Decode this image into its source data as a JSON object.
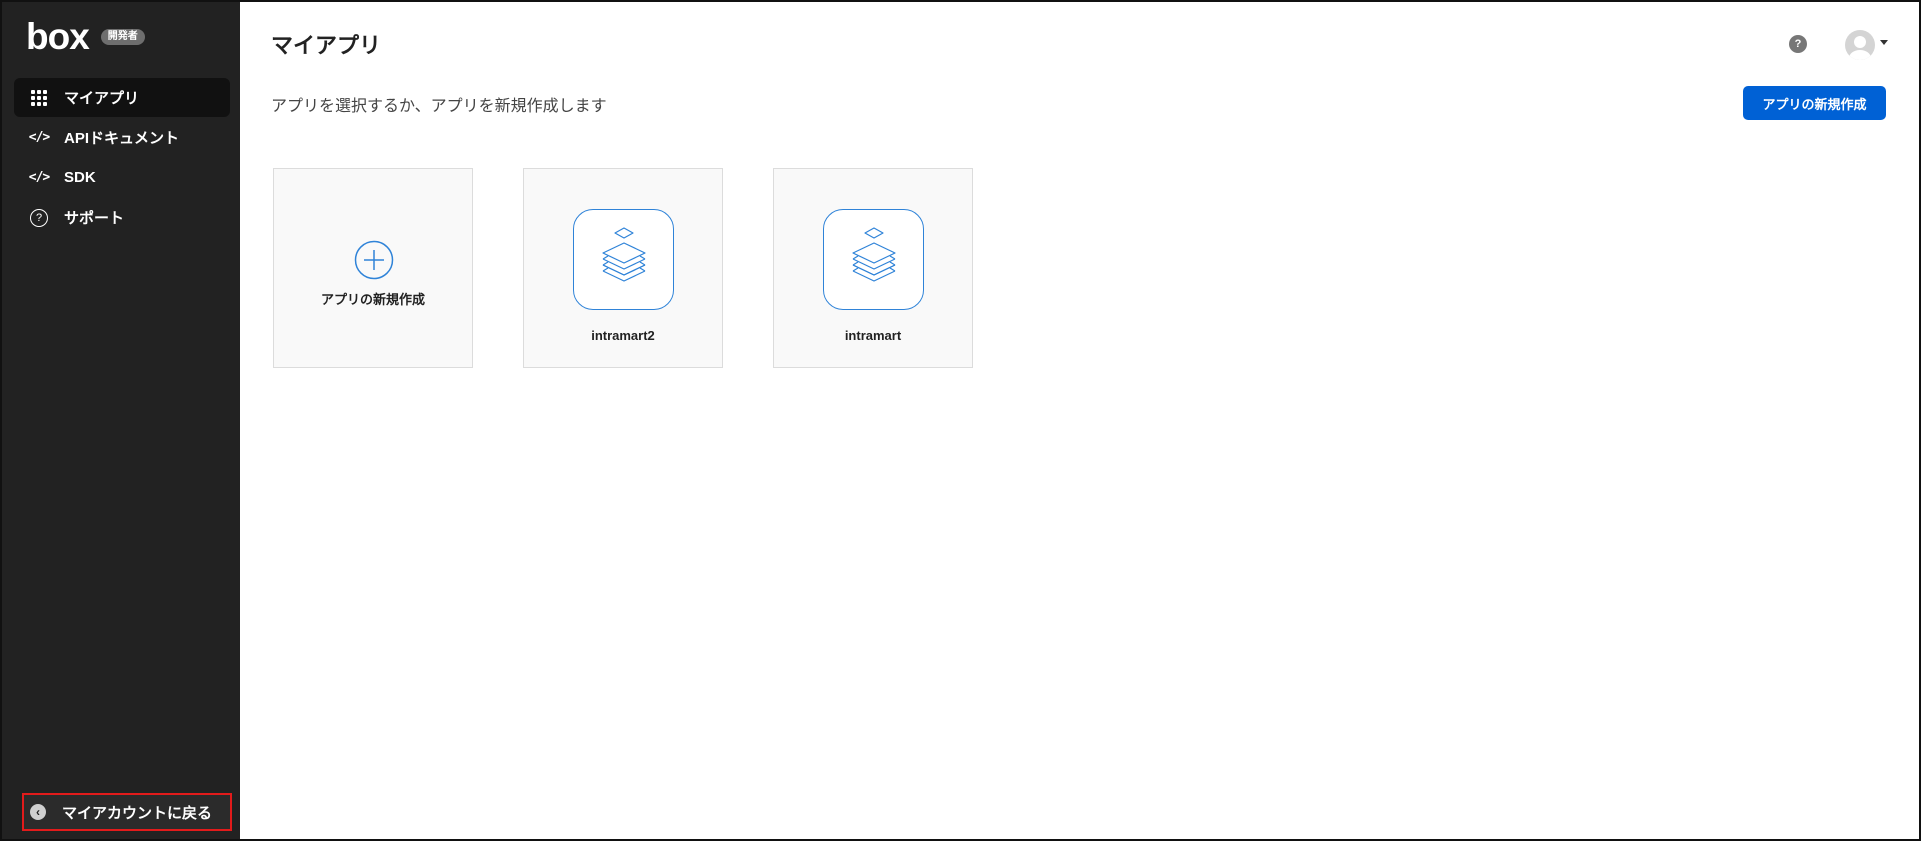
{
  "brand": {
    "logo_text": "box",
    "badge": "開発者"
  },
  "sidebar": {
    "items": [
      {
        "label": "マイアプリ",
        "icon": "grid-icon",
        "active": true
      },
      {
        "label": "APIドキュメント",
        "icon": "code-icon",
        "active": false
      },
      {
        "label": "SDK",
        "icon": "code-icon",
        "active": false
      },
      {
        "label": "サポート",
        "icon": "help-circle-icon",
        "active": false
      }
    ],
    "code_glyph": "</>",
    "help_glyph": "?",
    "back_label": "マイアカウントに戻る",
    "back_glyph": "‹"
  },
  "header": {
    "title": "マイアプリ",
    "subtitle": "アプリを選択するか、アプリを新規作成します",
    "help_glyph": "?",
    "create_button": "アプリの新規作成"
  },
  "cards": {
    "new_label": "アプリの新規作成",
    "apps": [
      {
        "name": "intramart2"
      },
      {
        "name": "intramart"
      }
    ]
  },
  "colors": {
    "sidebar_bg": "#222222",
    "accent": "#0061d5",
    "icon_blue": "#2f83d8",
    "highlight_border": "#e21b1b"
  }
}
